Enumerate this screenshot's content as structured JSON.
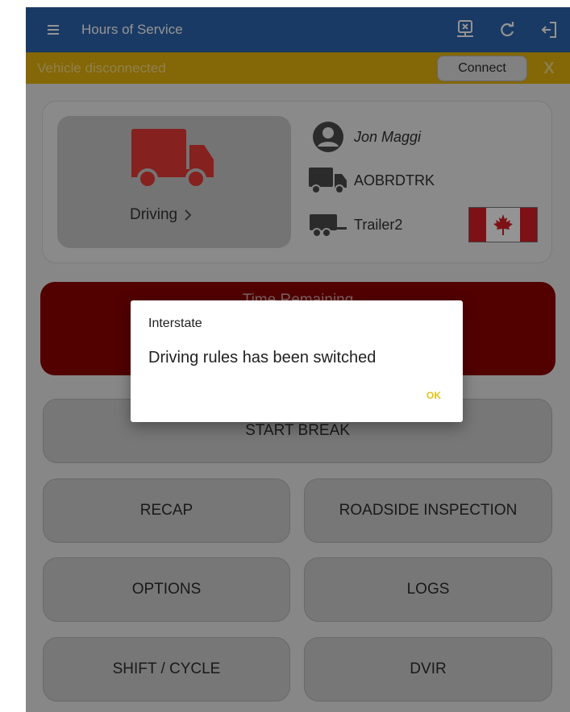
{
  "app_bar": {
    "title": "Hours of Service",
    "icons": [
      "menu-icon",
      "disconnect-device-icon",
      "refresh-icon",
      "logout-icon"
    ],
    "color": "#2b64ad"
  },
  "banner": {
    "message": "Vehicle disconnected",
    "connect_label": "Connect",
    "dismiss_label": "X",
    "color": "#e3b10b"
  },
  "driver_card": {
    "status": "Driving",
    "driver_name": "Jon Maggi",
    "vehicle": "AOBRDTRK",
    "trailer": "Trailer2",
    "status_icon": "truck-icon",
    "status_color": "#e53935",
    "flag": "canada-flag-icon"
  },
  "time_card": {
    "label": "Time Remaining",
    "color": "#8e0000"
  },
  "buttons": {
    "start_break": "START BREAK",
    "recap": "RECAP",
    "roadside_inspection": "ROADSIDE INSPECTION",
    "options": "OPTIONS",
    "logs": "LOGS",
    "shift_cycle": "SHIFT / CYCLE",
    "dvir": "DVIR"
  },
  "dialog": {
    "title": "Interstate",
    "message": "Driving rules has been switched",
    "ok_label": "OK",
    "ok_color": "#e6c21a"
  }
}
